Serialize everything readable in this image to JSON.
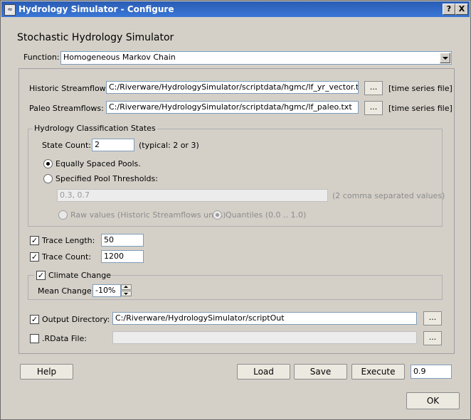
{
  "window": {
    "title": "Hydrology Simulator - Configure",
    "help_glyph": "?",
    "close_glyph": "X",
    "app_icon": "hydro-app-icon"
  },
  "heading": "Stochastic Hydrology Simulator",
  "function": {
    "label": "Function:",
    "value": "Homogeneous Markov Chain"
  },
  "historic": {
    "label": "Historic Streamflows:",
    "value": "C:/Riverware/HydrologySimulator/scriptdata/hgmc/lf_yr_vector.txt",
    "browse": "...",
    "hint": "[time series file]"
  },
  "paleo": {
    "label": "Paleo Streamflows:",
    "value": "C:/Riverware/HydrologySimulator/scriptdata/hgmc/lf_paleo.txt",
    "browse": "...",
    "hint": "[time series file]"
  },
  "states": {
    "title": "Hydrology Classification States",
    "count_label": "State Count:",
    "count_value": "2",
    "count_hint": "(typical: 2 or 3)",
    "equal_label": "Equally Spaced Pools.",
    "specified_label": "Specified Pool Thresholds:",
    "thresholds_value": "0.3, 0.7",
    "thresholds_hint": "(2 comma separated values)",
    "raw_label": "Raw values (Historic Streamflows units)",
    "quantiles_label": "Quantiles (0.0 .. 1.0)"
  },
  "trace_length": {
    "label": "Trace Length:",
    "value": "50"
  },
  "trace_count": {
    "label": "Trace Count:",
    "value": "1200"
  },
  "climate": {
    "label": "Climate Change",
    "mean_label": "Mean Change:",
    "mean_value": "-10%"
  },
  "output_dir": {
    "label": "Output Directory:",
    "value": "C:/Riverware/HydrologySimulator/scriptOut",
    "browse": "..."
  },
  "rdata": {
    "label": ".RData File:",
    "value": "",
    "browse": "..."
  },
  "buttons": {
    "help": "Help",
    "load": "Load",
    "save": "Save",
    "execute": "Execute",
    "execute_value": "0.9",
    "ok": "OK"
  },
  "check_glyph": "✓",
  "colors": {
    "titlebar": "#3a6fc8",
    "window_bg": "#d4d0c8",
    "field_border": "#7f9db9"
  }
}
